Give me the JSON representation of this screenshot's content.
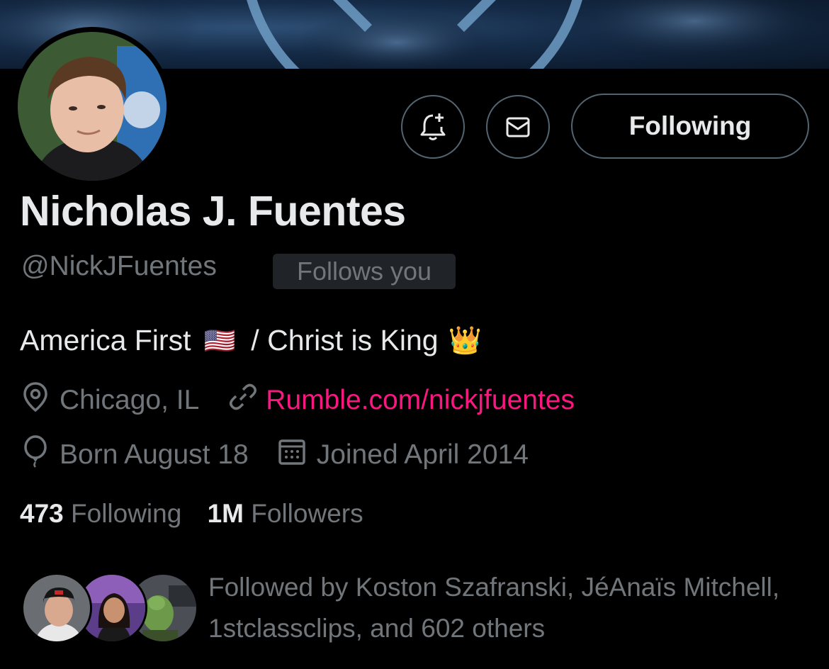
{
  "profile": {
    "name": "Nicholas J. Fuentes",
    "handle": "@NickJFuentes",
    "follows_you": "Follows you",
    "bio_part1": "America First",
    "bio_flag": "🇺🇸",
    "bio_part2": "/ Christ is King",
    "bio_crown": "👑",
    "location": "Chicago, IL",
    "website": "Rumble.com/nickjfuentes",
    "born": "Born August 18",
    "joined": "Joined April 2014"
  },
  "actions": {
    "follow_label": "Following",
    "notify_icon": "bell-plus-icon",
    "message_icon": "envelope-icon"
  },
  "stats": {
    "following_count": "473",
    "following_label": "Following",
    "followers_count": "1M",
    "followers_label": "Followers"
  },
  "followed_by": {
    "text": "Followed by Koston Szafranski, JéAnaïs Mitchell, 1stclassclips, and 602 others"
  },
  "colors": {
    "background": "#000000",
    "primary_text": "#e7e9ea",
    "secondary_text": "#71767b",
    "link": "#f91880",
    "border": "#536471"
  }
}
